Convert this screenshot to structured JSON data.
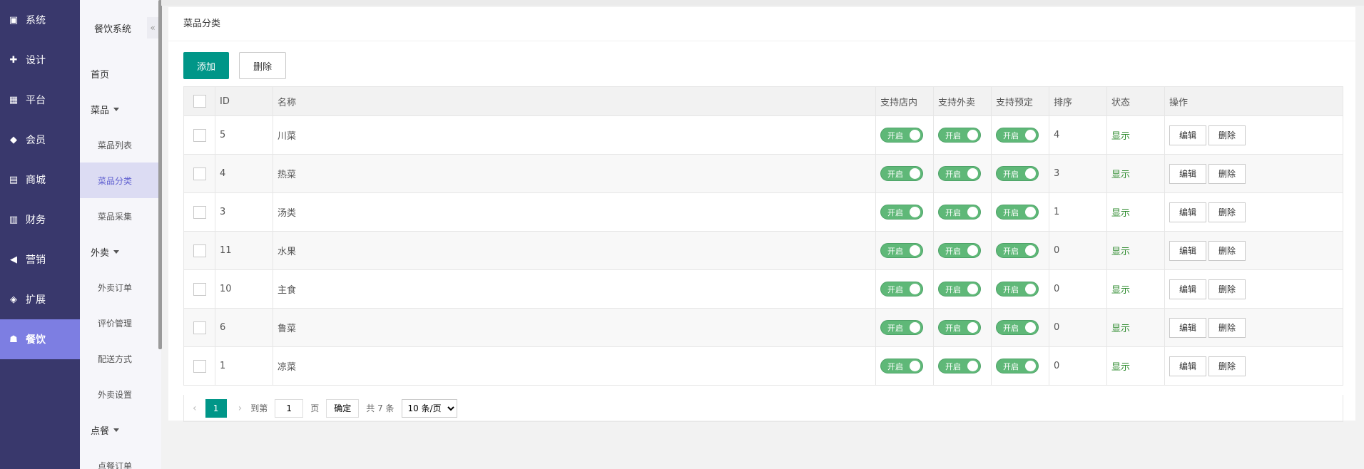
{
  "rail": [
    {
      "label": "系统",
      "icon": "terminal-icon"
    },
    {
      "label": "设计",
      "icon": "puzzle-icon"
    },
    {
      "label": "平台",
      "icon": "grid-icon"
    },
    {
      "label": "会员",
      "icon": "diamond-icon"
    },
    {
      "label": "商城",
      "icon": "shop-icon"
    },
    {
      "label": "财务",
      "icon": "wallet-icon"
    },
    {
      "label": "营销",
      "icon": "megaphone-icon"
    },
    {
      "label": "扩展",
      "icon": "cube-icon"
    },
    {
      "label": "餐饮",
      "icon": "cloche-icon",
      "active": true
    }
  ],
  "sub": {
    "title": "餐饮系统",
    "collapse": "«",
    "home": "首页",
    "group1": "菜品",
    "g1_items": [
      "菜品列表",
      "菜品分类",
      "菜品采集"
    ],
    "group2": "外卖",
    "g2_items": [
      "外卖订单",
      "评价管理",
      "配送方式",
      "外卖设置"
    ],
    "group3": "点餐",
    "g3_items": [
      "点餐订单"
    ]
  },
  "card": {
    "title": "菜品分类",
    "add": "添加",
    "del": "删除"
  },
  "table": {
    "headers": [
      "ID",
      "名称",
      "支持店内",
      "支持外卖",
      "支持预定",
      "排序",
      "状态",
      "操作"
    ],
    "switch_label": "开启",
    "status_label": "显示",
    "edit_label": "编辑",
    "del_label": "删除",
    "rows": [
      {
        "id": "5",
        "name": "川菜",
        "sort": "4"
      },
      {
        "id": "4",
        "name": "热菜",
        "sort": "3"
      },
      {
        "id": "3",
        "name": "汤类",
        "sort": "1"
      },
      {
        "id": "11",
        "name": "水果",
        "sort": "0"
      },
      {
        "id": "10",
        "name": "主食",
        "sort": "0"
      },
      {
        "id": "6",
        "name": "鲁菜",
        "sort": "0"
      },
      {
        "id": "1",
        "name": "凉菜",
        "sort": "0"
      }
    ]
  },
  "pager": {
    "prev": "‹",
    "current": "1",
    "next": "›",
    "goto": "到第",
    "goto_value": "1",
    "page": "页",
    "confirm": "确定",
    "total": "共 7 条",
    "size": "10 条/页"
  },
  "colors": {
    "rail_bg": "#39386c",
    "rail_active": "#7d7ee2",
    "primary": "#009688",
    "switch_on": "#5fb878"
  }
}
